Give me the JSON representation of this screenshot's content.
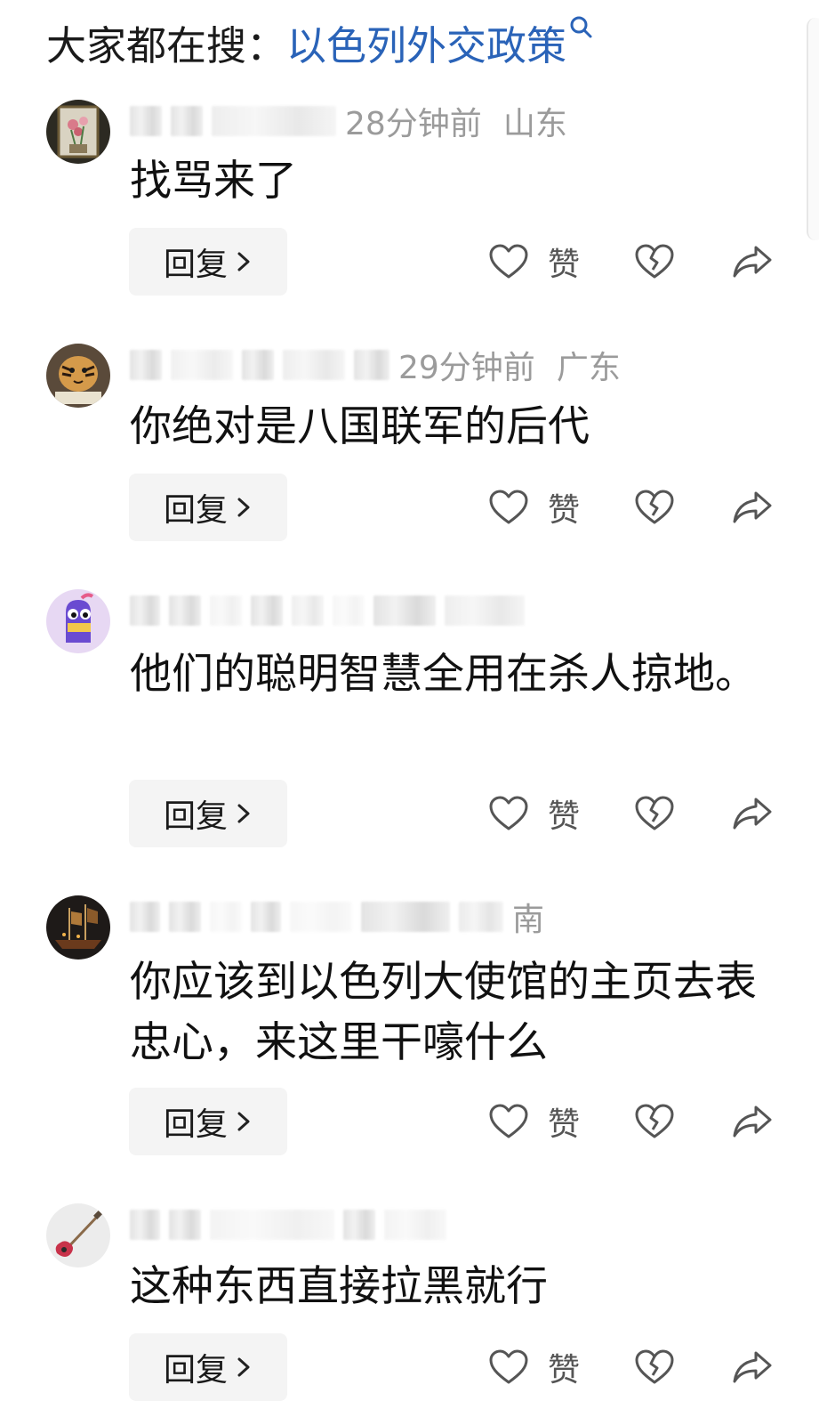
{
  "search": {
    "prefix": "大家都在搜：",
    "query": "以色列外交政策"
  },
  "comments": [
    {
      "time": "28分钟前",
      "region": "山东",
      "text": "找骂来了",
      "reply_label": "回复",
      "like_label": "赞"
    },
    {
      "time": "29分钟前",
      "region": "广东",
      "text": "你绝对是八国联军的后代",
      "reply_label": "回复",
      "like_label": "赞"
    },
    {
      "time": "",
      "region": "",
      "text": "他们的聪明智慧全用在杀人掠地。",
      "reply_label": "回复",
      "like_label": "赞"
    },
    {
      "time": "",
      "region": "南",
      "text": "你应该到以色列大使馆的主页去表忠心，来这里干嚎什么",
      "reply_label": "回复",
      "like_label": "赞"
    },
    {
      "time": "",
      "region": "",
      "text": "这种东西直接拉黑就行",
      "reply_label": "回复",
      "like_label": "赞"
    }
  ],
  "colors": {
    "link": "#2a63b8",
    "meta": "#9b9b9b",
    "button_bg": "#f4f4f4"
  },
  "icons": [
    "search-icon",
    "heart-icon",
    "broken-heart-icon",
    "share-arrow-icon",
    "chevron-right-icon"
  ]
}
